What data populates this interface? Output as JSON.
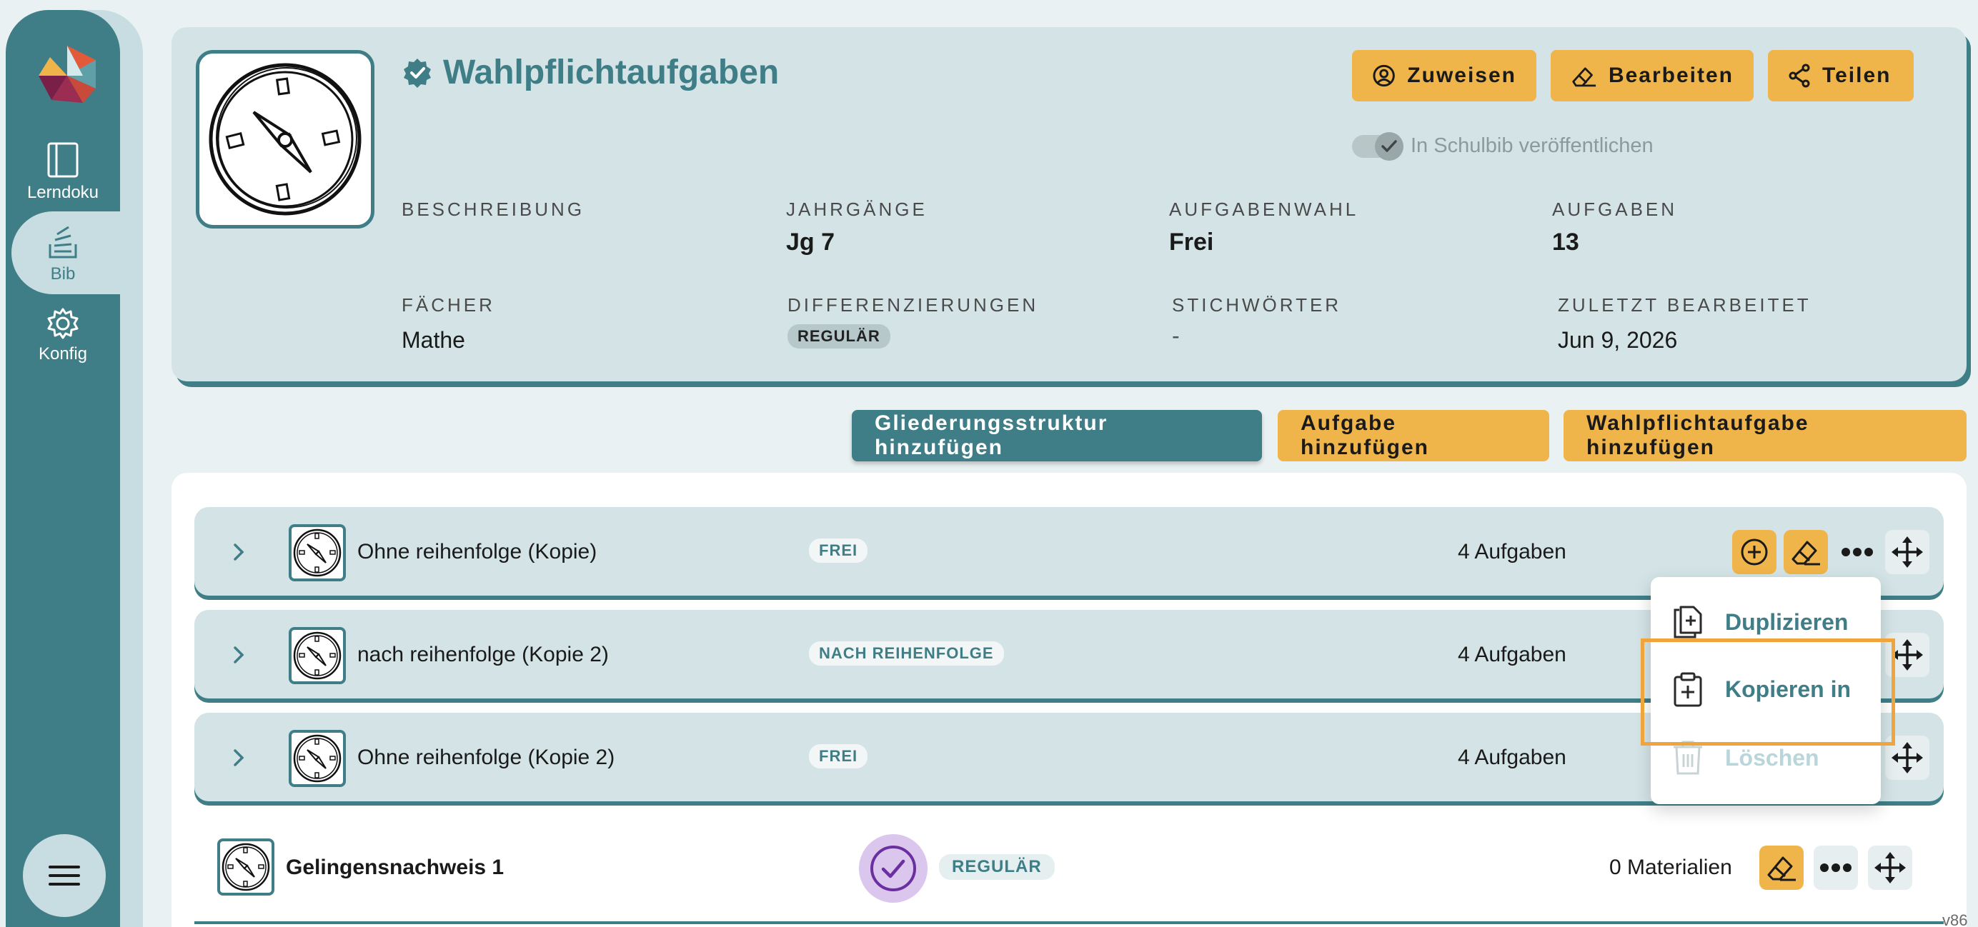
{
  "sidebar": {
    "items": [
      {
        "label": "Lerndoku",
        "icon": "book-icon"
      },
      {
        "label": "Bib",
        "icon": "library-icon"
      },
      {
        "label": "Konfig",
        "icon": "gear-icon"
      }
    ],
    "menu_icon": "hamburger-icon"
  },
  "header": {
    "title": "Wahlpflichtaufgaben",
    "buttons": {
      "assign": "Zuweisen",
      "edit": "Bearbeiten",
      "share": "Teilen"
    },
    "publish_toggle": {
      "label": "In Schulbib veröffentlichen",
      "checked": true
    },
    "meta": {
      "beschreibung_label": "BESCHREIBUNG",
      "beschreibung_value": "",
      "jahrgaenge_label": "JAHRGÄNGE",
      "jahrgaenge_value": "Jg 7",
      "aufgabenwahl_label": "AUFGABENWAHL",
      "aufgabenwahl_value": "Frei",
      "aufgaben_label": "AUFGABEN",
      "aufgaben_value": "13",
      "faecher_label": "FÄCHER",
      "faecher_value": "Mathe",
      "differenzierungen_label": "DIFFERENZIERUNGEN",
      "differenzierungen_value": "REGULÄR",
      "stichwoerter_label": "STICHWÖRTER",
      "stichwoerter_value": "-",
      "zuletzt_label": "ZULETZT BEARBEITET",
      "zuletzt_value": "Jun 9, 2026"
    }
  },
  "actions": {
    "add_structure": "Gliederungsstruktur hinzufügen",
    "add_task": "Aufgabe hinzufügen",
    "add_elective": "Wahlpflichtaufgabe hinzufügen"
  },
  "rows": [
    {
      "name": "Ohne reihenfolge (Kopie)",
      "type": "FREI",
      "count": "4 Aufgaben"
    },
    {
      "name": "nach reihenfolge (Kopie 2)",
      "type": "NACH REIHENFOLGE",
      "count": "4 Aufgaben"
    },
    {
      "name": "Ohne reihenfolge (Kopie 2)",
      "type": "FREI",
      "count": "4 Aufgaben"
    }
  ],
  "plain_row": {
    "name": "Gelingensnachweis 1",
    "type": "REGULÄR",
    "count": "0 Materialien"
  },
  "dropdown": {
    "duplicate": "Duplizieren",
    "copy_to": "Kopieren in",
    "delete": "Löschen"
  },
  "version": "v86",
  "colors": {
    "primary": "#3f7e87",
    "accent": "#f0b54a",
    "card": "#d4e4e6",
    "highlight": "#f0a43c"
  }
}
